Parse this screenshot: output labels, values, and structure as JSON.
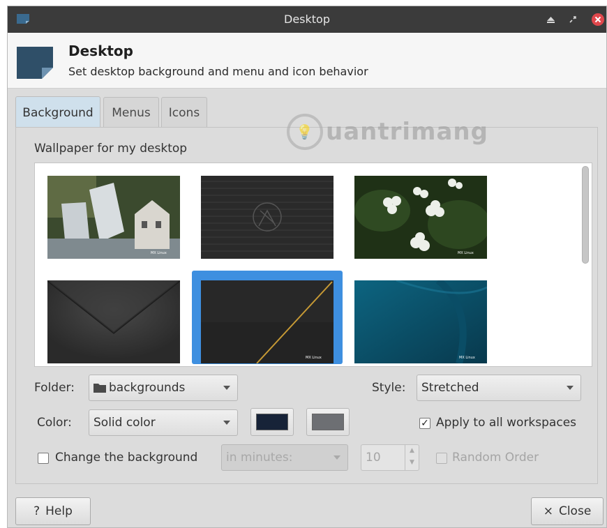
{
  "window": {
    "title": "Desktop"
  },
  "header": {
    "title": "Desktop",
    "subtitle": "Set desktop background and menu and icon behavior"
  },
  "tabs": [
    {
      "label": "Background",
      "active": true
    },
    {
      "label": "Menus",
      "active": false
    },
    {
      "label": "Icons",
      "active": false
    }
  ],
  "watermark": {
    "text": "uantrimang"
  },
  "background": {
    "wallpaper_label": "Wallpaper for my desktop",
    "thumbnails": [
      {
        "name": "waterfall-mill",
        "badge": "MX Linux"
      },
      {
        "name": "dark-stripes-logo",
        "badge": ""
      },
      {
        "name": "white-flowers",
        "badge": "MX Linux"
      },
      {
        "name": "dark-chevron",
        "badge": ""
      },
      {
        "name": "dark-gold-diagonal",
        "badge": "MX Linux",
        "selected": true
      },
      {
        "name": "teal-curves",
        "badge": "MX Linux"
      }
    ],
    "folder_label": "Folder:",
    "folder_value": "backgrounds",
    "style_label": "Style:",
    "style_value": "Stretched",
    "color_label": "Color:",
    "color_value": "Solid color",
    "color_primary": "#172338",
    "color_secondary": "#6d6f73",
    "apply_all_label": "Apply to all workspaces",
    "apply_all_checked": true,
    "change_bg_label": "Change the background",
    "change_bg_checked": false,
    "interval_value": "in minutes:",
    "interval_number": "10",
    "random_order_label": "Random Order"
  },
  "footer": {
    "help_label": "Help",
    "close_label": "Close"
  },
  "icons": {
    "help": "?",
    "close": "×",
    "checkmark": "✓"
  }
}
